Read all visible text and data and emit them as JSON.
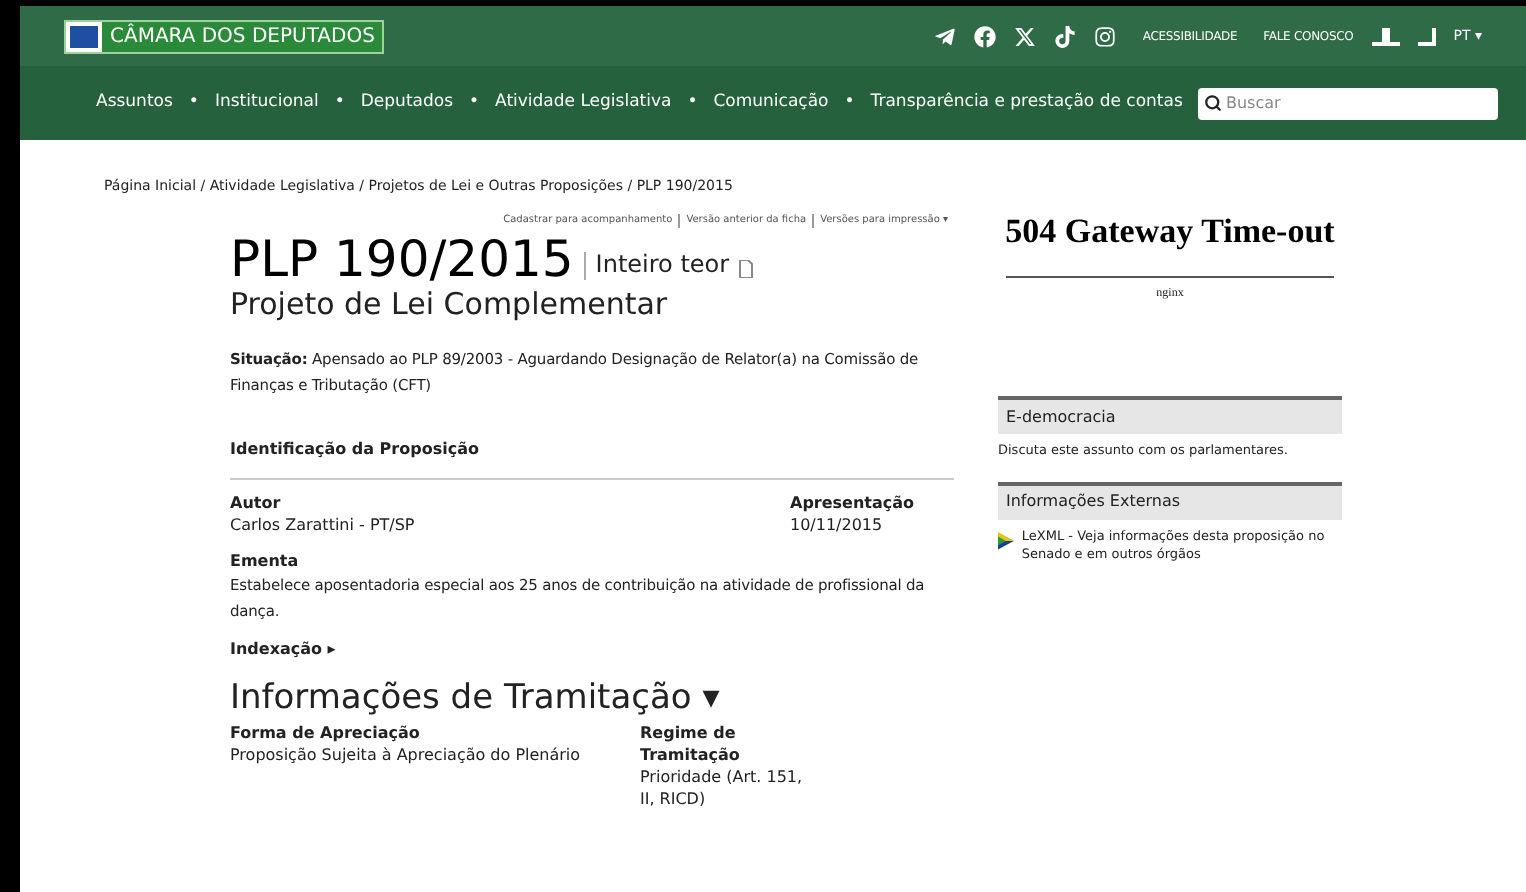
{
  "header": {
    "logo_text": "CÂMARA DOS DEPUTADOS",
    "links": [
      "ACESSIBILIDADE",
      "FALE CONOSCO"
    ],
    "language": "PT ▾"
  },
  "nav": {
    "items": [
      "Assuntos",
      "Institucional",
      "Deputados",
      "Atividade Legislativa",
      "Comunicação",
      "Transparência e prestação de contas"
    ],
    "separator": "•",
    "search": {
      "placeholder": "Buscar"
    }
  },
  "breadcrumb": "Página Inicial / Atividade Legislativa / Projetos de Lei e Outras Proposições / PLP 190/2015",
  "actions": [
    "Cadastrar para acompanhamento",
    "Versão anterior da ficha",
    "Versões para impressão ▾"
  ],
  "title": "PLP 190/2015",
  "full_text_link": "Inteiro teor",
  "subtitle": "Projeto de Lei Complementar",
  "situacao": {
    "label": "Situação:",
    "text": "Apensado ao PLP 89/2003 - Aguardando Designação de Relator(a) na Comissão de Finanças e Tributação (CFT)"
  },
  "identificacao": {
    "heading": "Identificação da Proposição",
    "fields": [
      {
        "label": "Autor",
        "value": "Carlos Zarattini - PT/SP"
      },
      {
        "label": "Apresentação",
        "value": "10/11/2015"
      }
    ],
    "ementa": {
      "label": "Ementa",
      "value": "Estabelece aposentadoria especial aos 25 anos de contribuição na atividade de profissional da dança."
    },
    "indexacao": {
      "label": "Indexação ▸",
      "expanded": false
    }
  },
  "tramitacao": {
    "heading": "Informações de Tramitação ▾",
    "fields": [
      {
        "label": "Forma de Apreciação",
        "value": "Proposição Sujeita à Apreciação do Plenário"
      },
      {
        "label": "Regime de Tramitação",
        "value": "Prioridade (Art. 151, II, RICD)"
      }
    ]
  },
  "sidebar": {
    "error_title": "504 Gateway Time-out",
    "error_server": "nginx",
    "boxes": [
      {
        "title": "E-democracia",
        "text": "Discuta este assunto com os parlamentares.",
        "kind": "text"
      },
      {
        "title": "Informações Externas",
        "text": "LeXML - Veja informações desta proposição no Senado e em outros órgãos",
        "kind": "link"
      }
    ]
  }
}
